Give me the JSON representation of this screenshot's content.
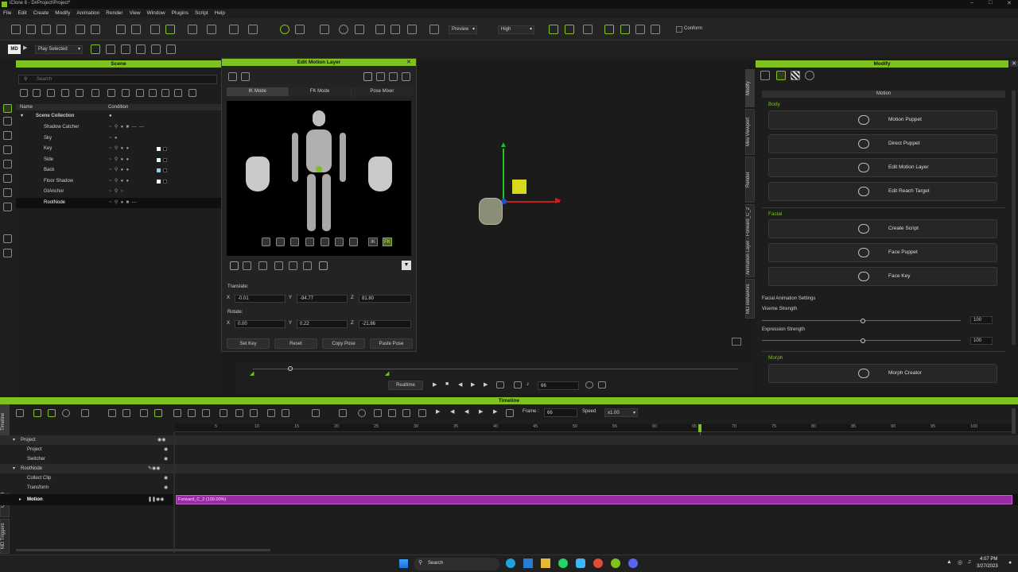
{
  "window": {
    "title": "iClone 8 - D#Project\\Project*"
  },
  "menu": [
    "File",
    "Edit",
    "Create",
    "Modify",
    "Animation",
    "Render",
    "View",
    "Window",
    "Plugins",
    "Script",
    "Help"
  ],
  "toolbar": {
    "preview": "Preview",
    "quality": "High",
    "conform": "Conform",
    "play_selected": "Play Selected"
  },
  "scene": {
    "title": "Scene",
    "search_placeholder": "Search",
    "col_name": "Name",
    "col_condition": "Condition",
    "items": [
      "Scene Collection",
      "Shadow Catcher",
      "Sky",
      "Key",
      "Side",
      "Back",
      "Floor Shadow",
      "GIAnchor",
      "RootNode"
    ]
  },
  "eml": {
    "title": "Edit Motion Layer",
    "tabs": [
      "IK Mode",
      "FK Mode",
      "Pose Mixer"
    ],
    "translate_label": "Translate:",
    "rotate_label": "Rotate:",
    "axes": [
      "X",
      "Y",
      "Z"
    ],
    "translate": [
      "-0.01",
      "-94.77",
      "81.80"
    ],
    "rotate": [
      "0.00",
      "0.22",
      "-21.86"
    ],
    "buttons": [
      "Set Key",
      "Reset",
      "Copy Pose",
      "Paste Pose"
    ],
    "ik_label": "IK",
    "fk_label": "FK"
  },
  "viewport": {
    "realtime": "Realtime",
    "frame": "66"
  },
  "modify": {
    "title": "Modify",
    "subtitle": "Motion",
    "tabs": [
      "Modify",
      "Mini Viewport",
      "Render",
      "Animation Layer - Forward_C_2",
      "MD Behaviors"
    ],
    "body_label": "Body",
    "facial_label": "Facial",
    "morph_label": "Morph",
    "body_buttons": [
      "Motion Puppet",
      "Direct Puppet",
      "Edit Motion Layer",
      "Edit Reach Target"
    ],
    "facial_buttons": [
      "Create Script",
      "Face Puppet",
      "Face Key"
    ],
    "facial_settings": "Facial Animation Settings",
    "viseme_label": "Viseme Strength",
    "viseme_value": "100",
    "expression_label": "Expression Strength",
    "expression_value": "100",
    "morph_buttons": [
      "Morph Creator"
    ]
  },
  "timeline": {
    "title": "Timeline",
    "frame_label": "Frame :",
    "frame_value": "66",
    "speed_label": "Speed",
    "speed_value": "x1.00",
    "ticks": [
      "5",
      "10",
      "15",
      "20",
      "25",
      "30",
      "35",
      "40",
      "45",
      "50",
      "55",
      "60",
      "65",
      "70",
      "75",
      "80",
      "85",
      "90",
      "95",
      "100"
    ],
    "tracks": [
      "Project",
      "Project",
      "Switcher",
      "RootNode",
      "Collect Clip",
      "Transform",
      "Motion"
    ],
    "clip": "Forward_C_2 (100.00%)",
    "side_tabs": [
      "Timeline",
      "Curve Editor - Base Motion",
      "MD Triggers"
    ]
  },
  "taskbar": {
    "search": "Search",
    "time": "4:07 PM",
    "date": "3/27/2023"
  },
  "colors": {
    "accent": "#7fc21f",
    "clip": "#9b2ba8"
  }
}
